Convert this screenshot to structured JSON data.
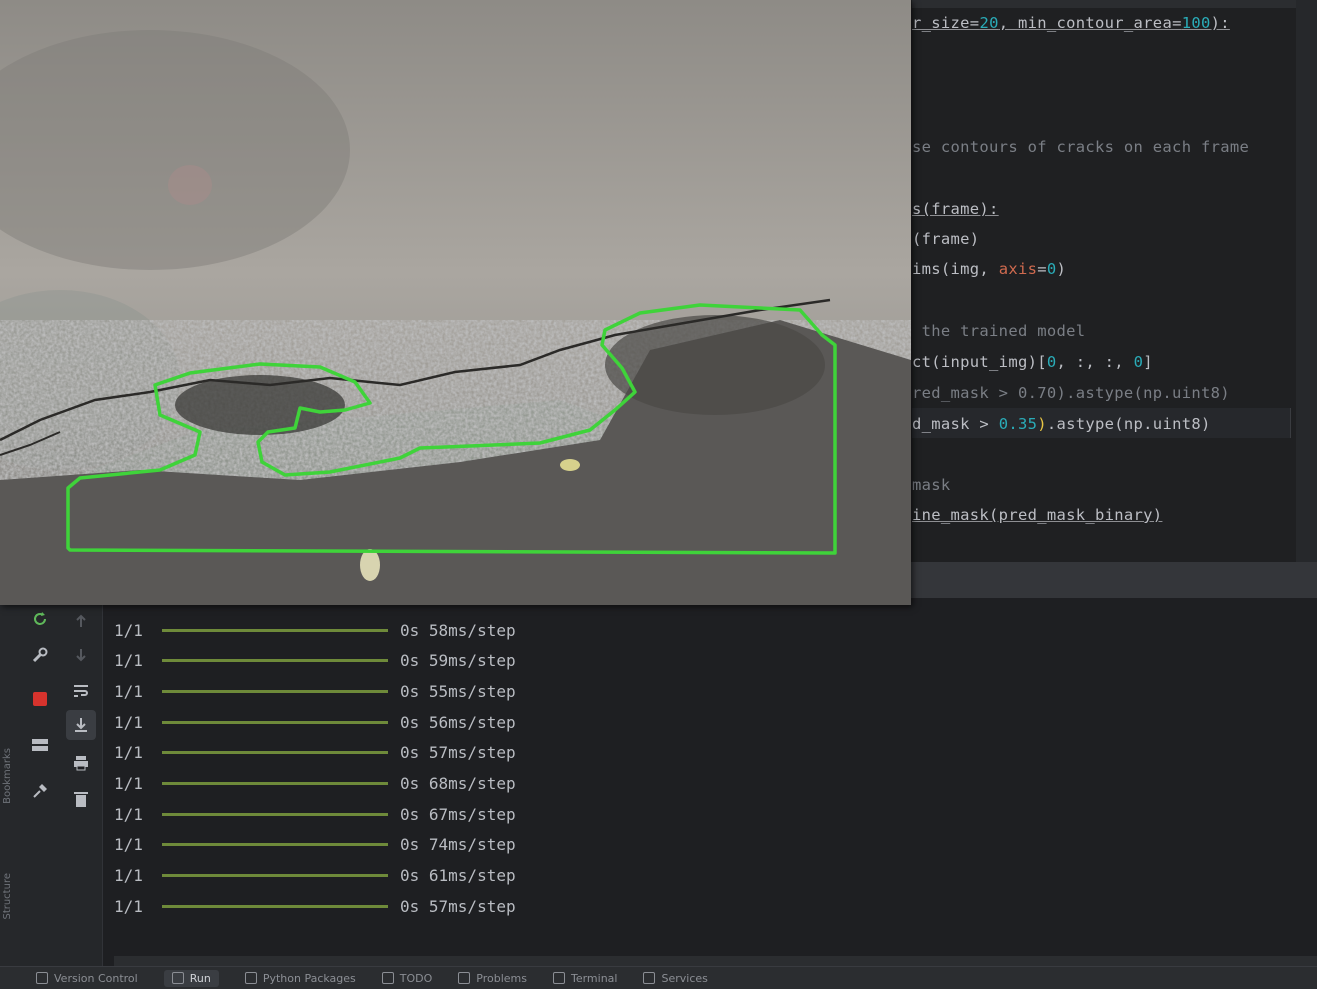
{
  "editor": {
    "code_lines": [
      {
        "segments": [
          {
            "t": "r_size=",
            "c": "ul"
          },
          {
            "t": "20",
            "c": "num ul"
          },
          {
            "t": ", min_contour_area=",
            "c": "ul"
          },
          {
            "t": "100",
            "c": "num ul"
          },
          {
            "t": "):",
            "c": "ul"
          }
        ]
      },
      {
        "segments": [
          {
            "t": "se contours of cracks on each frame",
            "c": "cm"
          }
        ]
      },
      {
        "segments": [
          {
            "t": "s(frame):",
            "c": "ul"
          }
        ]
      },
      {
        "segments": [
          {
            "t": "(frame)",
            "c": ""
          }
        ]
      },
      {
        "segments": [
          {
            "t": "ims(img, ",
            "c": ""
          },
          {
            "t": "axis",
            "c": "kw"
          },
          {
            "t": "=",
            "c": ""
          },
          {
            "t": "0",
            "c": "num"
          },
          {
            "t": ")",
            "c": ""
          }
        ]
      },
      {
        "segments": [
          {
            "t": " the trained model",
            "c": "cm"
          }
        ]
      },
      {
        "segments": [
          {
            "t": "ct(input_img)[",
            "c": ""
          },
          {
            "t": "0",
            "c": "num"
          },
          {
            "t": ", :, :, ",
            "c": ""
          },
          {
            "t": "0",
            "c": "num"
          },
          {
            "t": "]",
            "c": ""
          }
        ]
      },
      {
        "segments": [
          {
            "t": "red_mask > 0.70).astype(np.uint8)",
            "c": "cm"
          }
        ]
      },
      {
        "segments": [
          {
            "t": "d_mask > ",
            "c": ""
          },
          {
            "t": "0.35",
            "c": "num"
          },
          {
            "t": ")",
            "c": "br"
          },
          {
            "t": ".astype(np.uint8)",
            "c": ""
          }
        ]
      },
      {
        "segments": [
          {
            "t": "mask",
            "c": "cm"
          }
        ]
      },
      {
        "segments": [
          {
            "t": "ine_mask(pred_mask_binary)",
            "c": "ul"
          }
        ]
      }
    ]
  },
  "run_output": {
    "rows": [
      {
        "step": "1/1",
        "eta": "0s 58ms/step"
      },
      {
        "step": "1/1",
        "eta": "0s 59ms/step"
      },
      {
        "step": "1/1",
        "eta": "0s 55ms/step"
      },
      {
        "step": "1/1",
        "eta": "0s 56ms/step"
      },
      {
        "step": "1/1",
        "eta": "0s 57ms/step"
      },
      {
        "step": "1/1",
        "eta": "0s 68ms/step"
      },
      {
        "step": "1/1",
        "eta": "0s 67ms/step"
      },
      {
        "step": "1/1",
        "eta": "0s 74ms/step"
      },
      {
        "step": "1/1",
        "eta": "0s 61ms/step"
      },
      {
        "step": "1/1",
        "eta": "0s 57ms/step"
      }
    ]
  },
  "side_labels": {
    "top": "Bookmarks",
    "bottom": "Structure"
  },
  "bottom_bar": {
    "tabs": [
      {
        "label": "Version Control",
        "icon": "branch-icon",
        "active": false
      },
      {
        "label": "Run",
        "icon": "run-icon",
        "active": true
      },
      {
        "label": "Python Packages",
        "icon": "packages-icon",
        "active": false
      },
      {
        "label": "TODO",
        "icon": "todo-icon",
        "active": false
      },
      {
        "label": "Problems",
        "icon": "problems-icon",
        "active": false
      },
      {
        "label": "Terminal",
        "icon": "terminal-icon",
        "active": false
      },
      {
        "label": "Services",
        "icon": "services-icon",
        "active": false
      }
    ]
  },
  "tool_icons": [
    "rerun-icon",
    "wrench-icon",
    "stop-icon",
    "layout-icon",
    "pin-icon",
    "up-arrow-icon",
    "down-arrow-icon",
    "soft-wrap-icon",
    "scroll-to-end-icon",
    "print-icon",
    "trash-icon"
  ],
  "colors": {
    "contour": "#3fd33a",
    "editor_bg": "#1f2022",
    "run_bg": "#1e1f22",
    "progress": "#6e8a3a",
    "number": "#2aacb8",
    "keyword": "#cf6a4f"
  }
}
